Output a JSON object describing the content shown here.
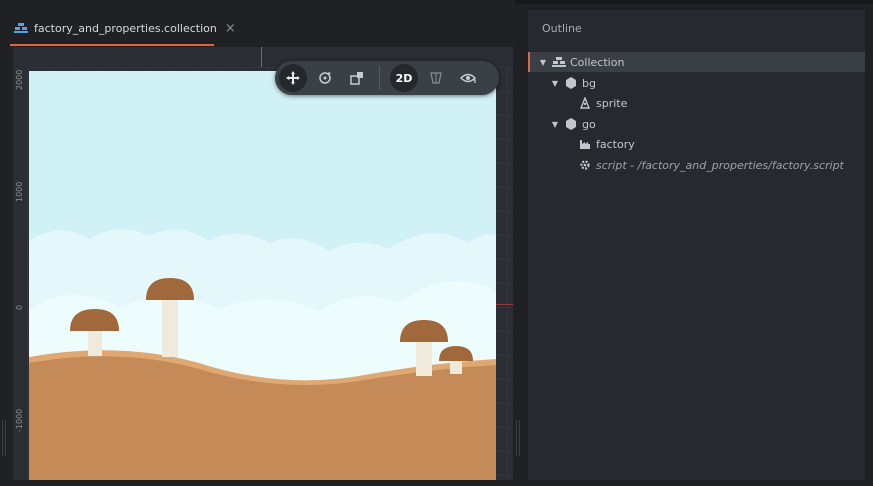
{
  "tab": {
    "label": "factory_and_properties.collection",
    "close": "×"
  },
  "ruler": {
    "labels": [
      "2000",
      "1000",
      "0",
      "-1000"
    ]
  },
  "toolbar": {
    "mode_label": "2D"
  },
  "outline": {
    "title": "Outline",
    "items": [
      {
        "label": "Collection"
      },
      {
        "label": "bg"
      },
      {
        "label": "sprite"
      },
      {
        "label": "go"
      },
      {
        "label": "factory"
      },
      {
        "label": "script - /factory_and_properties/factory.script"
      }
    ]
  },
  "colors": {
    "accent": "#e0663f",
    "sky": "#d0f1f6",
    "ground": "#c48a57",
    "mushroom_cap": "#a0683b",
    "mushroom_stem": "#f0eadc"
  }
}
